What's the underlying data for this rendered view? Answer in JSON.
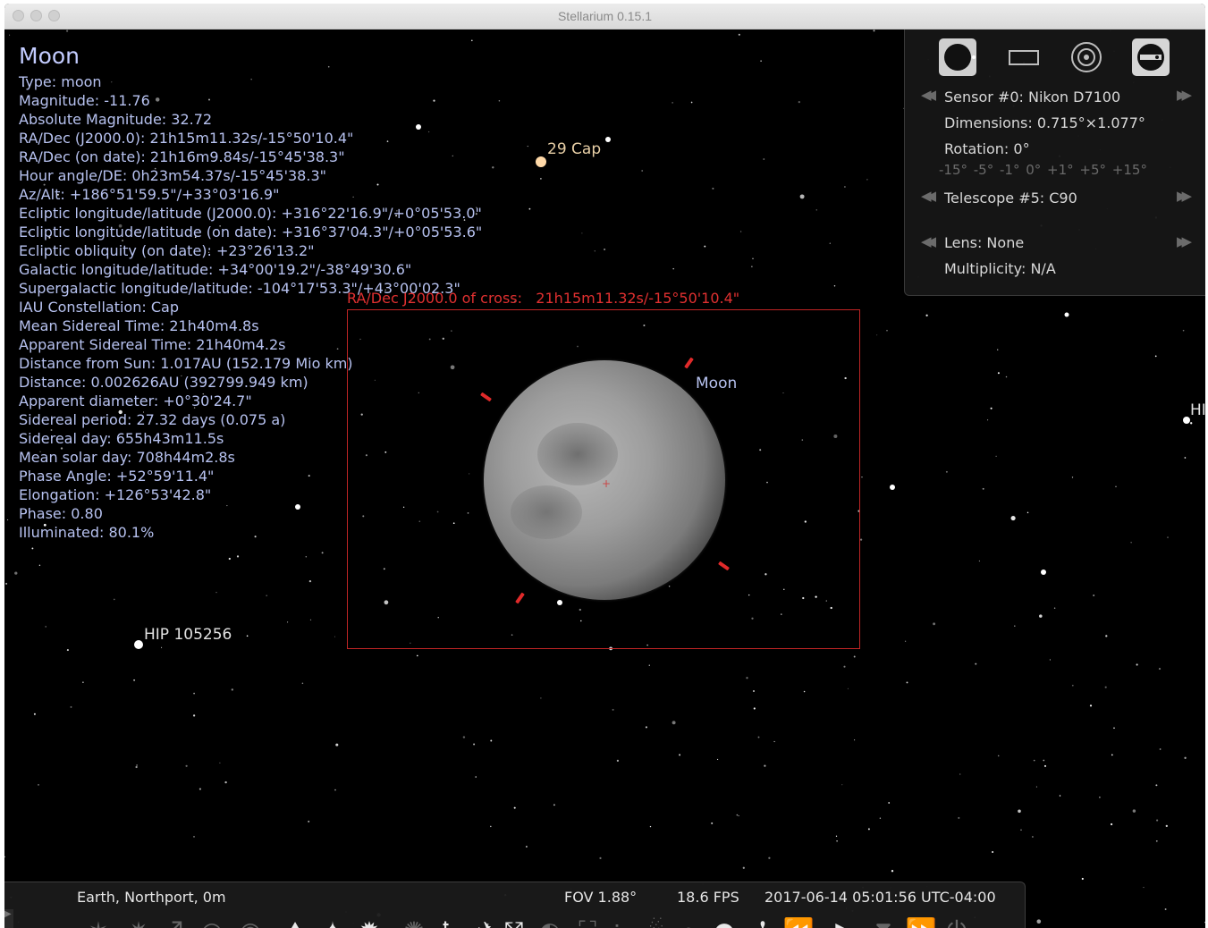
{
  "window": {
    "title": "Stellarium 0.15.1"
  },
  "object_info": {
    "name": "Moon",
    "lines": [
      "Type: moon",
      "Magnitude: -11.76",
      "Absolute Magnitude: 32.72",
      "RA/Dec (J2000.0): 21h15m11.32s/-15°50'10.4\"",
      "RA/Dec (on date): 21h16m9.84s/-15°45'38.3\"",
      "Hour angle/DE: 0h23m54.37s/-15°45'38.3\"",
      "Az/Alt: +186°51'59.5\"/+33°03'16.9\"",
      "Ecliptic longitude/latitude (J2000.0): +316°22'16.9\"/+0°05'53.0\"",
      "Ecliptic longitude/latitude (on date): +316°37'04.3\"/+0°05'53.6\"",
      "Ecliptic obliquity (on date): +23°26'13.2\"",
      "Galactic longitude/latitude: +34°00'19.2\"/-38°49'30.6\"",
      "Supergalactic longitude/latitude: -104°17'53.3\"/+43°00'02.3\"",
      "IAU Constellation: Cap",
      "Mean Sidereal Time: 21h40m4.8s",
      "Apparent Sidereal Time: 21h40m4.2s",
      "Distance from Sun: 1.017AU (152.179 Mio km)",
      "Distance: 0.002626AU (392799.949 km)",
      "Apparent diameter: +0°30'24.7\"",
      "Sidereal period: 27.32 days (0.075 a)",
      "Sidereal day: 655h43m11.5s",
      "Mean solar day: 708h44m2.8s",
      "Phase Angle: +52°59'11.4\"",
      "Elongation: +126°53'42.8\"",
      "Phase: 0.80",
      "Illuminated: 80.1%"
    ]
  },
  "sky_labels": {
    "cap29": "29 Cap",
    "hip105256": "HIP 105256",
    "moon": "Moon",
    "hi_edge": "HI"
  },
  "cross_readout": {
    "prefix": "RA/Dec J2000.0 of cross:",
    "value": "21h15m11.32s/-15°50'10.4\""
  },
  "oculars_panel": {
    "sensor": "Sensor #0: Nikon D7100",
    "dimensions": "Dimensions: 0.715°×1.077°",
    "rotation": "Rotation: 0°",
    "rotation_scale": "-15° -5° -1° 0° +1° +5° +15°",
    "telescope": "Telescope #5: C90",
    "lens": "Lens: None",
    "multiplicity": "Multiplicity: N/A",
    "tools": [
      "ocular-icon",
      "sensor-frame-icon",
      "telrad-icon",
      "configuration-icon"
    ]
  },
  "bottom_bar": {
    "location": "Earth, Northport, 0m",
    "fov": "FOV 1.88°",
    "fps": "18.6 FPS",
    "datetime": "2017-06-14 05:01:56 UTC-04:00",
    "buttons": [
      {
        "name": "constellation-lines-icon",
        "glyph": "✶",
        "active": false
      },
      {
        "name": "constellation-labels-icon",
        "glyph": "✷",
        "active": false
      },
      {
        "name": "constellation-art-icon",
        "glyph": "♐",
        "active": false
      },
      {
        "name": "equatorial-grid-icon",
        "glyph": "◎",
        "active": false
      },
      {
        "name": "azimuthal-grid-icon",
        "glyph": "◉",
        "active": false
      },
      {
        "name": "ground-icon",
        "glyph": "⛰",
        "active": true
      },
      {
        "name": "cardinal-points-icon",
        "glyph": "✦",
        "active": true
      },
      {
        "name": "atmosphere-icon",
        "glyph": "✹",
        "active": true
      },
      {
        "name": "nebulas-icon",
        "glyph": "✺",
        "active": false
      },
      {
        "name": "planets-icon",
        "glyph": "♄",
        "active": true
      },
      {
        "name": "satellites-icon",
        "glyph": "✈",
        "active": true
      },
      {
        "name": "equatorial-mount-icon",
        "glyph": "⤧",
        "active": true
      },
      {
        "name": "night-mode-icon",
        "glyph": "◐",
        "active": false
      },
      {
        "name": "full-screen-icon",
        "glyph": "⛶",
        "active": false
      },
      {
        "name": "exoplanets-icon",
        "glyph": "⁘",
        "active": false
      },
      {
        "name": "meteors-icon",
        "glyph": "☄",
        "active": false
      },
      {
        "name": "search-icon",
        "glyph": "⌕",
        "active": false
      },
      {
        "name": "oculars-icon",
        "glyph": "●",
        "active": true
      },
      {
        "name": "telescope-control-icon",
        "glyph": "✢",
        "active": true
      },
      {
        "name": "rewind-icon",
        "glyph": "⏪",
        "active": false
      },
      {
        "name": "play-icon",
        "glyph": "▶",
        "active": true
      },
      {
        "name": "set-time-now-icon",
        "glyph": "⧗",
        "active": false
      },
      {
        "name": "fast-forward-icon",
        "glyph": "⏩",
        "active": false
      },
      {
        "name": "quit-icon",
        "glyph": "⏻",
        "active": false
      }
    ]
  },
  "colors": {
    "info_text": "#b7c2f0",
    "cross_red": "#e03030",
    "panel_bg": "#161616",
    "bar_bg": "#1a1a1a"
  }
}
